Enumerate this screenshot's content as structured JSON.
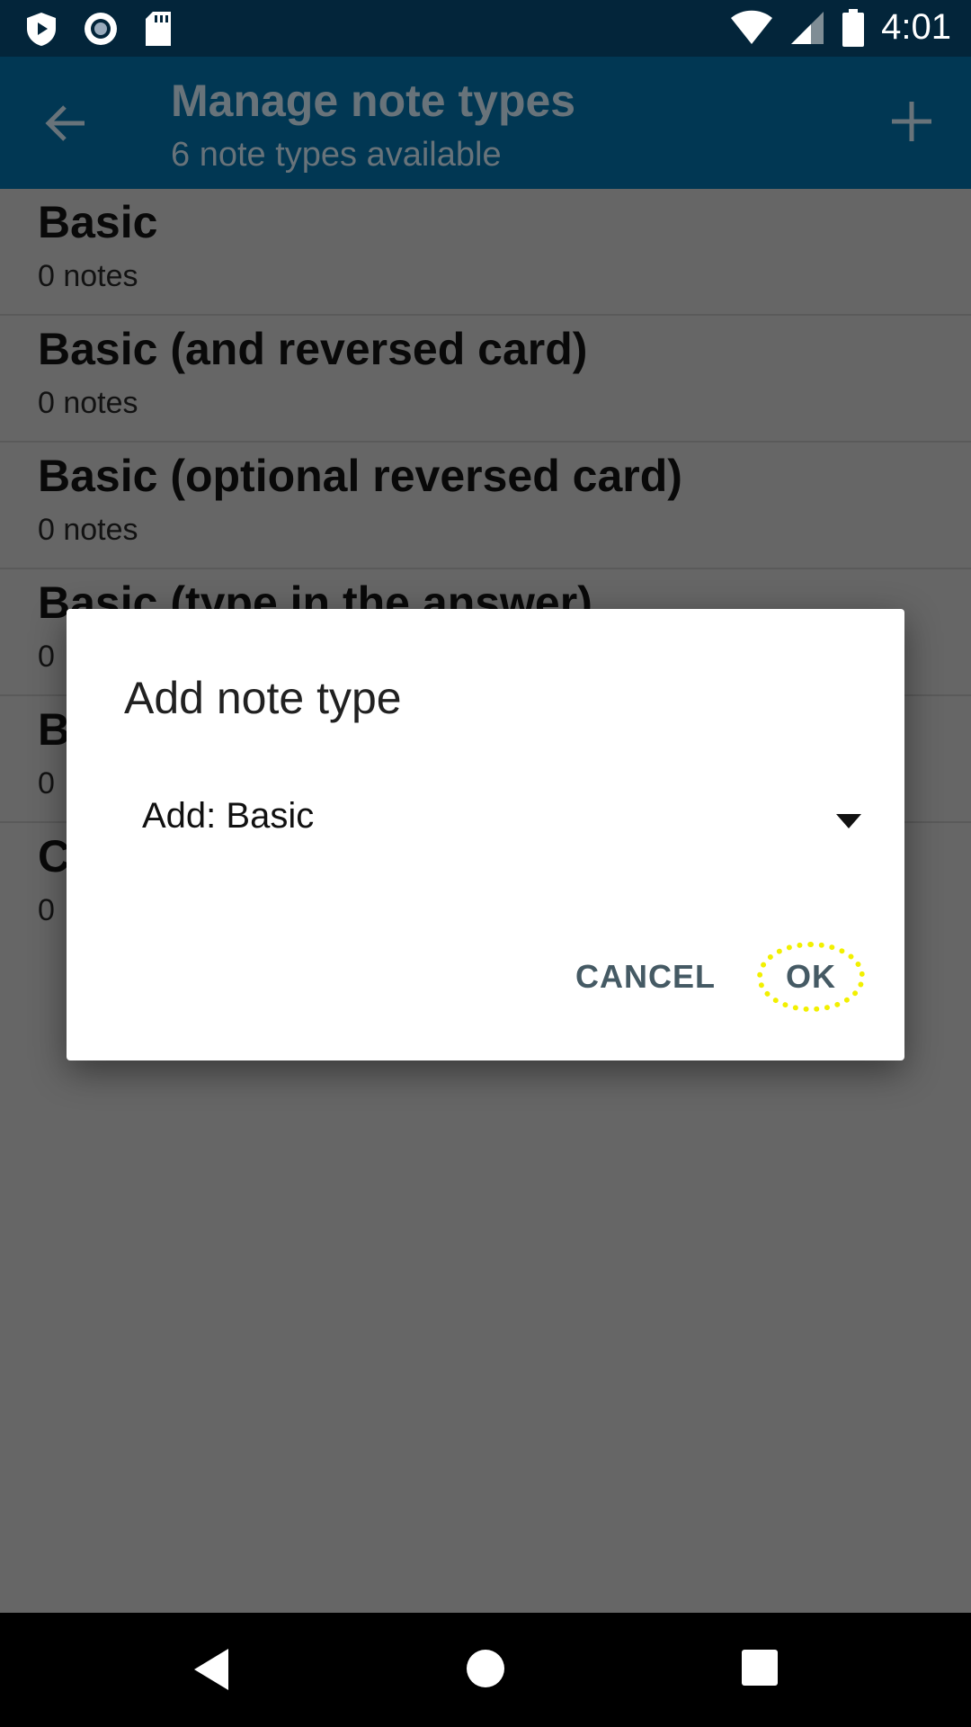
{
  "status_bar": {
    "time": "4:01",
    "left_icons": [
      "play-protect-icon",
      "record-icon",
      "sd-card-icon"
    ],
    "right_icons": [
      "wifi-icon",
      "cell-signal-icon",
      "battery-icon"
    ]
  },
  "app_bar": {
    "title": "Manage note types",
    "subtitle": "6 note types available",
    "back_icon": "arrow-back-icon",
    "add_icon": "plus-icon"
  },
  "note_types": [
    {
      "name": "Basic",
      "count": "0 notes"
    },
    {
      "name": "Basic (and reversed card)",
      "count": "0 notes"
    },
    {
      "name": "Basic (optional reversed card)",
      "count": "0 notes"
    },
    {
      "name": "Basic (type in the answer)",
      "count": "0"
    },
    {
      "name": "B",
      "count": "0"
    },
    {
      "name": "C",
      "count": "0"
    }
  ],
  "dialog": {
    "title": "Add note type",
    "spinner_value": "Add: Basic",
    "cancel_label": "CANCEL",
    "ok_label": "OK"
  },
  "colors": {
    "status_bar": "#03253a",
    "app_bar": "#024466",
    "button_text": "#455a64",
    "highlight": "#f2f000"
  }
}
